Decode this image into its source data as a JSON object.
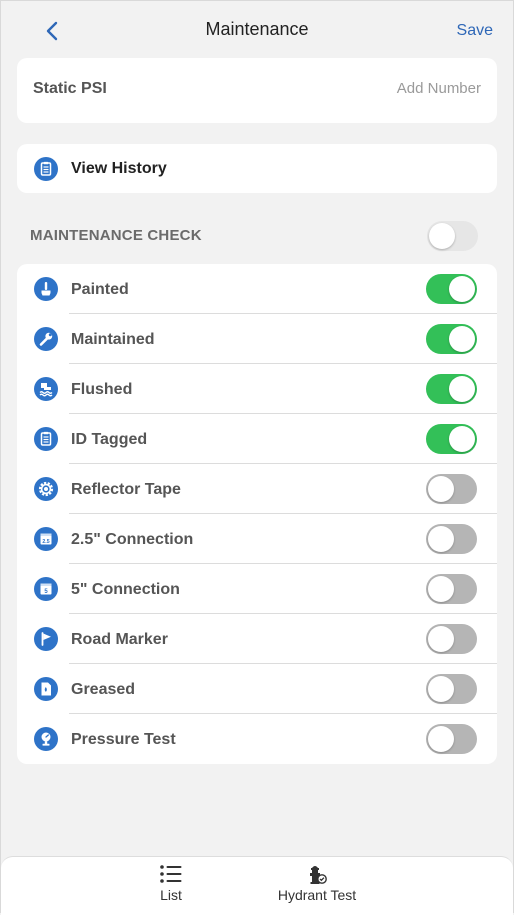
{
  "header": {
    "title": "Maintenance",
    "save_label": "Save"
  },
  "static_psi": {
    "label": "Static PSI",
    "placeholder": "Add Number",
    "value": ""
  },
  "history": {
    "label": "View History"
  },
  "maintenance_check": {
    "label": "MAINTENANCE CHECK",
    "enabled": false
  },
  "items": [
    {
      "label": "Painted",
      "icon": "paint-brush-icon",
      "on": true
    },
    {
      "label": "Maintained",
      "icon": "wrench-icon",
      "on": true
    },
    {
      "label": "Flushed",
      "icon": "flush-icon",
      "on": true
    },
    {
      "label": "ID Tagged",
      "icon": "clipboard-icon",
      "on": true
    },
    {
      "label": "Reflector Tape",
      "icon": "gear-icon",
      "on": false
    },
    {
      "label": "2.5\" Connection",
      "icon": "calendar-2-5-icon",
      "on": false
    },
    {
      "label": "5\" Connection",
      "icon": "calendar-5-icon",
      "on": false
    },
    {
      "label": "Road Marker",
      "icon": "flag-icon",
      "on": false
    },
    {
      "label": "Greased",
      "icon": "grease-document-icon",
      "on": false
    },
    {
      "label": "Pressure Test",
      "icon": "pressure-gauge-icon",
      "on": false
    }
  ],
  "tabs": [
    {
      "label": "List",
      "icon": "list-icon"
    },
    {
      "label": "Hydrant Test",
      "icon": "hydrant-icon"
    }
  ],
  "colors": {
    "accent": "#2e67b7",
    "icon_blue": "#2e73c8",
    "toggle_on": "#33c058",
    "toggle_off": "#b5b5b5"
  }
}
